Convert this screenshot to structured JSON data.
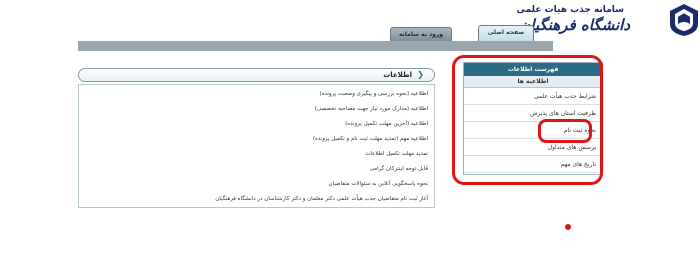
{
  "header": {
    "logo_title": "سامانه جذب هیات علمی",
    "logo_script": "دانشگاه فرهنگیان"
  },
  "tabs": [
    {
      "label": "صفحه اصلی",
      "active": true
    },
    {
      "label": "ورود به سامانه",
      "active": false
    }
  ],
  "sidebar": {
    "title": "فهرست اطلاعات",
    "subtitle": "اطلاعیه ها",
    "items": [
      "شرایط جذب هیأت علمی",
      "ظرفیت استان های پذیرش",
      "نحوه ثبت نام",
      "پرسش های متداول",
      "تاریخ های مهم"
    ]
  },
  "announcements": {
    "title": "اطلاعات",
    "items": [
      "اطلاعیه (نحوه بررسی و پیگیری وضعیت پرونده)",
      "اطلاعیه (مدارک مورد نیاز جهت مصاحبه تخصصی)",
      "اطلاعیه (آخرین مهلت تکمیل پرونده)",
      "اطلاعیه مهم (تمدید مهلت ثبت نام و تکمیل پرونده)",
      "تمدید مهلت تکمیل اطلاعات",
      "قابل توجه اینترکان گرامی",
      "نحوه پاسخگویی آنلاین به سئوالات متقاضیان",
      "آغاز ثبت نام متقاضیان جذب هیأت علمی دکتر معلمان و دکتر کارشناسان در دانشگاه فرهنگیان"
    ]
  },
  "colors": {
    "annotation_red": "#e01515",
    "sidebar_title_bg": "#2c6b86",
    "tab_bar": "#9aa6ad"
  }
}
